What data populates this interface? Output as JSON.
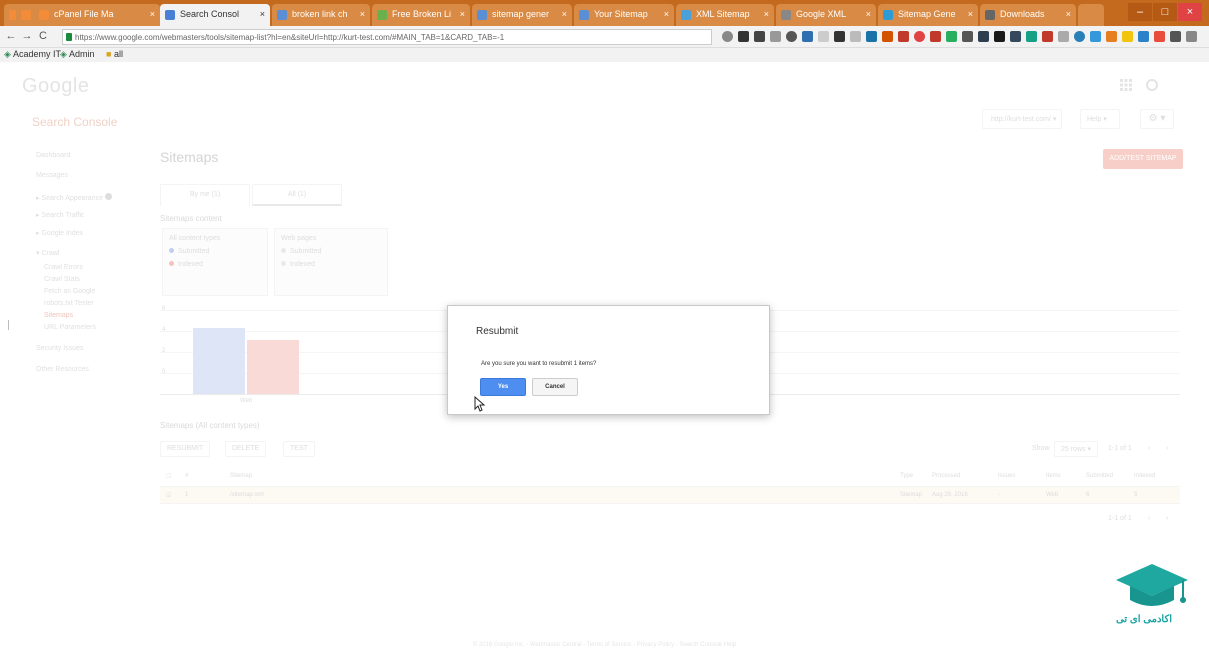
{
  "browser": {
    "tabs": [
      {
        "label": "cPanel File Ma"
      },
      {
        "label": "Search Consol"
      },
      {
        "label": "broken link ch"
      },
      {
        "label": "Free Broken Li"
      },
      {
        "label": "sitemap gener"
      },
      {
        "label": "Your Sitemap"
      },
      {
        "label": "XML Sitemap"
      },
      {
        "label": "Google XML"
      },
      {
        "label": "Sitemap Gene"
      },
      {
        "label": "Downloads"
      }
    ],
    "url": "https://www.google.com/webmasters/tools/sitemap-list?hl=en&siteUrl=http://kurt-test.com/#MAIN_TAB=1&CARD_TAB=-1",
    "bookmarks": [
      "Academy IT",
      "Admin",
      "all"
    ]
  },
  "page": {
    "logo": "Google",
    "brand": "Search Console",
    "title": "Sitemaps",
    "add_button": "ADD/TEST SITEMAP",
    "top_control": "http://kurt-test.com/",
    "help": "Help",
    "nav": [
      "Dashboard",
      "Messages",
      "Search Appearance",
      "Search Traffic",
      "Google Index",
      "Crawl",
      "Crawl Errors",
      "Crawl Stats",
      "Fetch as Google",
      "robots.txt Tester",
      "Sitemaps",
      "URL Parameters",
      "Security Issues",
      "Other Resources"
    ],
    "subtabs": [
      "By me (1)",
      "All (1)"
    ],
    "content_label": "Sitemaps content",
    "legend_all": {
      "title": "All content types",
      "items": [
        "Submitted",
        "Indexed"
      ]
    },
    "legend_web": {
      "title": "Web pages",
      "items": [
        "Submitted",
        "Indexed"
      ]
    },
    "y_labels": [
      "6",
      "4",
      "2",
      "0"
    ],
    "x_label": "Web",
    "table_label": "Sitemaps (All content types)",
    "table_buttons": [
      "RESUBMIT",
      "DELETE",
      "TEST"
    ],
    "pager_top": "1-1 of 1",
    "show_label": "Show",
    "show_value": "25 rows",
    "columns": [
      "#",
      "Sitemap",
      "Type",
      "Processed",
      "Issues",
      "Items",
      "Submitted",
      "Indexed"
    ],
    "row": {
      "num": "1",
      "path": "/sitemap.xml",
      "type": "Sitemap",
      "processed": "Aug 29, 2016",
      "issues": "-",
      "items": "Web",
      "submitted": "6",
      "indexed": "5"
    },
    "pager_bottom": "1-1 of 1",
    "footer": "© 2016 Google Inc. - Webmaster Central - Terms of Service - Privacy Policy - Search Console Help"
  },
  "dialog": {
    "title": "Resubmit",
    "message": "Are you sure you want to resubmit 1 items?",
    "yes": "Yes",
    "cancel": "Cancel"
  },
  "watermark": {
    "text": "اکادمی ای تی"
  },
  "colors": {
    "accent": "#4d8ef0",
    "tabstrip": "#c46a1e",
    "bar_submitted": "#ccd8f1",
    "bar_indexed": "#f6c7c0"
  }
}
